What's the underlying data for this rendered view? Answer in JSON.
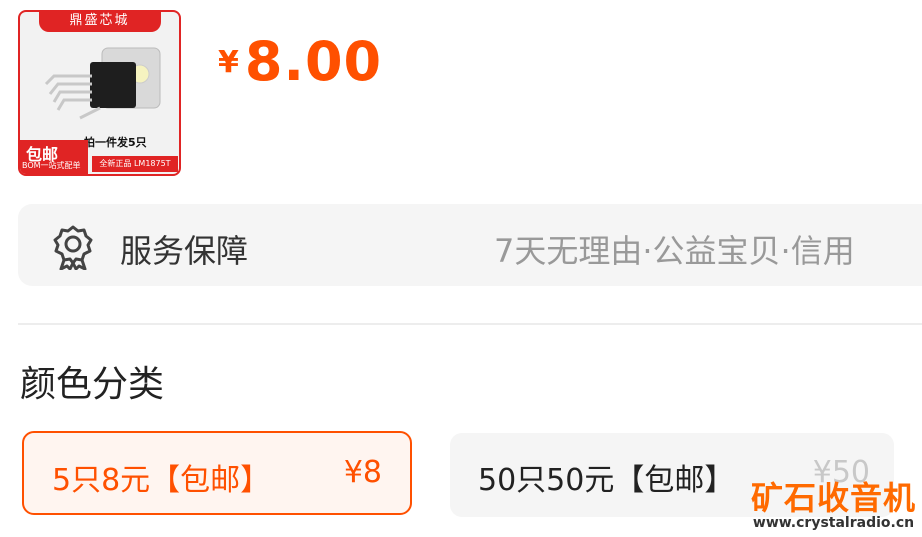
{
  "product": {
    "thumbnail": {
      "banner": "鼎盛芯城",
      "caption": "拍一件发5只",
      "badge": "包邮",
      "badge_sub": "BOM一站式配单",
      "model_tag": "全新正品 LM1875T"
    },
    "price": {
      "currency": "¥",
      "value": "8.00"
    }
  },
  "service": {
    "icon": "shield-award-icon",
    "label": "服务保障",
    "description": "7天无理由·公益宝贝·信用"
  },
  "variants": {
    "title": "颜色分类",
    "options": [
      {
        "name": "5只8元【包邮】",
        "price": "¥8",
        "selected": true
      },
      {
        "name": "50只50元【包邮】",
        "price": "¥50",
        "selected": false
      }
    ]
  },
  "watermark": {
    "title": "矿石收音机",
    "url": "www.crystalradio.cn"
  },
  "colors": {
    "accent": "#ff5000",
    "thumb_red": "#e02424",
    "muted_text": "#999999",
    "panel_bg": "#f5f5f5"
  }
}
